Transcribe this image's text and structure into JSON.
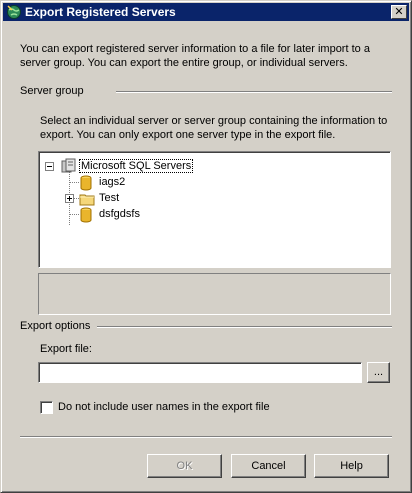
{
  "window": {
    "title": "Export Registered Servers",
    "close_label": "✕"
  },
  "intro": {
    "text": "You can export registered server information to a file for later import to a server group. You can export the entire group, or individual servers."
  },
  "server_group": {
    "label": "Server group",
    "hint": "Select an individual server or server group containing the information to export. You can only export one server type in the export file.",
    "tree": {
      "root": {
        "label": "Microsoft SQL Servers",
        "expanded": true,
        "selected": true
      },
      "children": [
        {
          "label": "iags2",
          "type": "server"
        },
        {
          "label": "Test",
          "type": "group",
          "expanded": false
        },
        {
          "label": "dsfgdsfs",
          "type": "server"
        }
      ]
    }
  },
  "export_options": {
    "label": "Export options",
    "file_label": "Export file:",
    "file_value": "",
    "browse_label": "...",
    "checkbox_label": "Do not include user names in the export file",
    "checkbox_checked": false
  },
  "buttons": {
    "ok": "OK",
    "cancel": "Cancel",
    "help": "Help"
  },
  "colors": {
    "titlebar": "#0a246a",
    "dialog_bg": "#d4d0c8",
    "folder": "#f5d77a",
    "server_cylinder": "#e9b52c"
  }
}
